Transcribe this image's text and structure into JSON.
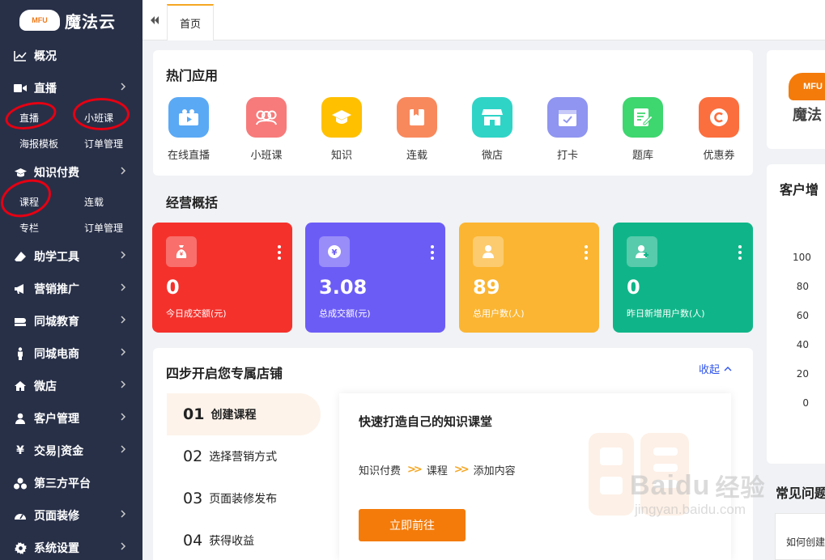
{
  "brand": {
    "logo_mark": "MFU",
    "name": "魔法云"
  },
  "sidebar": {
    "items": [
      {
        "label": "概况",
        "icon": "chart-line-icon",
        "has_sub": false
      },
      {
        "label": "直播",
        "icon": "video-camera-icon",
        "has_sub": true
      },
      {
        "label": "知识付费",
        "icon": "graduation-cap-icon",
        "has_sub": true
      },
      {
        "label": "助学工具",
        "icon": "eraser-icon",
        "has_sub": true
      },
      {
        "label": "营销推广",
        "icon": "megaphone-icon",
        "has_sub": true
      },
      {
        "label": "同城教育",
        "icon": "book-icon",
        "has_sub": true
      },
      {
        "label": "同城电商",
        "icon": "male-icon",
        "has_sub": true
      },
      {
        "label": "微店",
        "icon": "home-icon",
        "has_sub": true
      },
      {
        "label": "客户管理",
        "icon": "user-icon",
        "has_sub": true
      },
      {
        "label": "交易|资金",
        "icon": "yen-icon",
        "has_sub": true
      },
      {
        "label": "第三方平台",
        "icon": "cubes-icon",
        "has_sub": false
      },
      {
        "label": "页面装修",
        "icon": "dashboard-icon",
        "has_sub": true
      },
      {
        "label": "系统设置",
        "icon": "gear-icon",
        "has_sub": true
      }
    ],
    "live_sub": [
      "直播",
      "小班课",
      "海报模板",
      "订单管理"
    ],
    "knowledge_sub": [
      "课程",
      "连载",
      "专栏",
      "订单管理"
    ]
  },
  "topbar": {
    "home_tab": "首页"
  },
  "hot_apps": {
    "title": "热门应用",
    "items": [
      {
        "label": "在线直播",
        "color": "#5aa9f5",
        "icon": "camera-icon"
      },
      {
        "label": "小班课",
        "color": "#f77b7b",
        "icon": "group-icon"
      },
      {
        "label": "知识",
        "color": "#ffc000",
        "icon": "cap-icon"
      },
      {
        "label": "连载",
        "color": "#f8895d",
        "icon": "bookmark-icon"
      },
      {
        "label": "微店",
        "color": "#2fd4c7",
        "icon": "store-icon"
      },
      {
        "label": "打卡",
        "color": "#8f95f0",
        "icon": "calendar-check-icon"
      },
      {
        "label": "题库",
        "color": "#3ed66f",
        "icon": "edit-icon"
      },
      {
        "label": "优惠券",
        "color": "#fb6f3e",
        "icon": "coupon-icon"
      }
    ]
  },
  "overview": {
    "title": "经营概括",
    "stats": [
      {
        "value": "0",
        "label": "今日成交额(元)",
        "color": "#f5312c",
        "icon": "money-bag-icon"
      },
      {
        "value": "3.08",
        "label": "总成交额(元)",
        "color": "#6c5cf6",
        "icon": "yen-coin-icon"
      },
      {
        "value": "89",
        "label": "总用户数(人)",
        "color": "#fbb532",
        "icon": "user-icon"
      },
      {
        "value": "0",
        "label": "昨日新增用户数(人)",
        "color": "#0fb588",
        "icon": "user-plus-icon"
      }
    ]
  },
  "steps": {
    "title": "四步开启您专属店铺",
    "collapse_label": "收起",
    "items": [
      {
        "num": "01",
        "label": "创建课程"
      },
      {
        "num": "02",
        "label": "选择营销方式"
      },
      {
        "num": "03",
        "label": "页面装修发布"
      },
      {
        "num": "04",
        "label": "获得收益"
      }
    ],
    "panel": {
      "title": "快速打造自己的知识课堂",
      "crumbs": [
        "知识付费",
        "课程",
        "添加内容"
      ],
      "button": "立即前往"
    }
  },
  "right": {
    "logo_mark": "MFU",
    "logo_text": "魔法",
    "chart_title": "客户增",
    "faq_title": "常见问题",
    "faq_item": "如何创建"
  },
  "chart_data": {
    "type": "line",
    "title": "客户增",
    "y_ticks": [
      "100",
      "80",
      "60",
      "40",
      "20",
      "0"
    ],
    "ylim": [
      0,
      100
    ],
    "series": []
  },
  "watermark": {
    "brand": "Baidu",
    "suffix": "经验",
    "url": "jingyan.baidu.com"
  }
}
